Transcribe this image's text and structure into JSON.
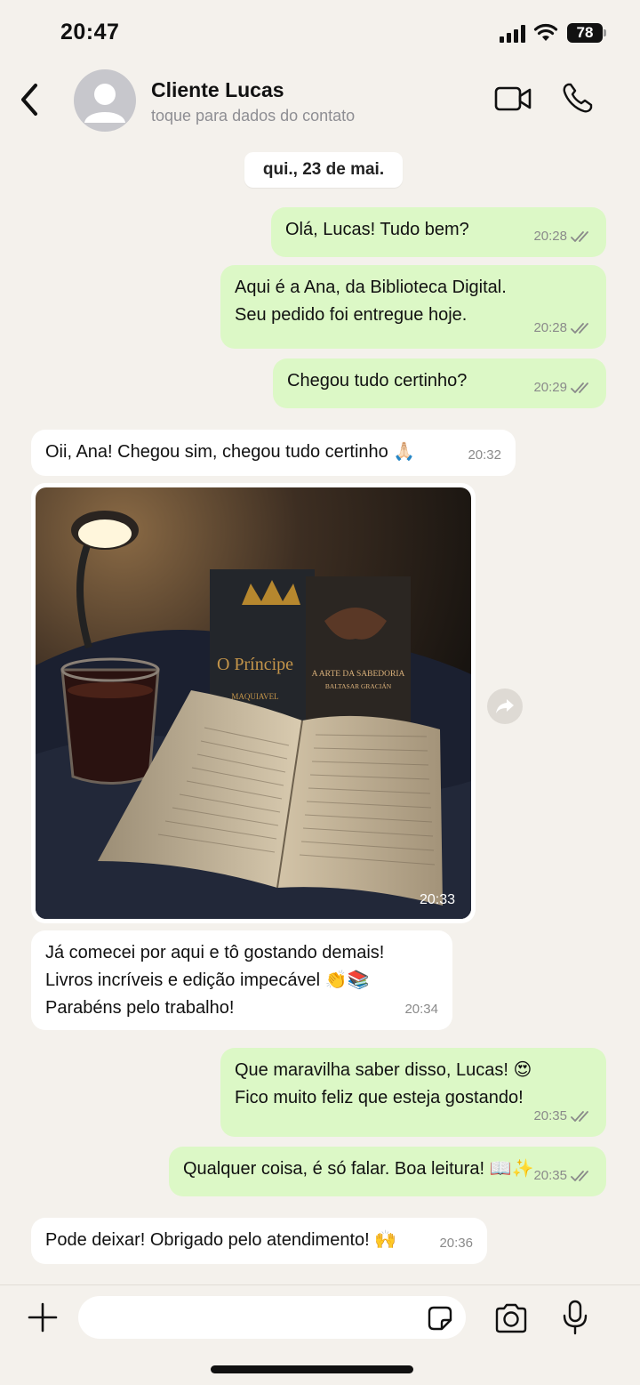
{
  "status_bar": {
    "time": "20:47",
    "battery": "78"
  },
  "header": {
    "contact_name": "Cliente Lucas",
    "contact_subtitle": "toque para dados do contato"
  },
  "chat": {
    "date_label": "qui., 23 de mai.",
    "messages": [
      {
        "direction": "out",
        "text": "Olá, Lucas! Tudo bem?",
        "time": "20:28",
        "status": "read"
      },
      {
        "direction": "out",
        "text": "Aqui é a Ana, da Biblioteca Digital.\nSeu pedido foi entregue hoje.",
        "time": "20:28",
        "status": "read"
      },
      {
        "direction": "out",
        "text": "Chegou tudo certinho?",
        "time": "20:29",
        "status": "read"
      },
      {
        "direction": "in",
        "text": "Oii, Ana! Chegou sim, chegou tudo certinho 🙏🏻",
        "time": "20:32"
      },
      {
        "direction": "in",
        "type": "image",
        "time": "20:33",
        "image_books": [
          "O Príncipe",
          "MAQUIAVEL",
          "A ARTE DA SABEDORIA",
          "BALTASAR GRACIÁN"
        ]
      },
      {
        "direction": "in",
        "text": "Já comecei por aqui e tô gostando demais!\nLivros incríveis e edição impecável 👏📚\nParabéns pelo trabalho!",
        "time": "20:34"
      },
      {
        "direction": "out",
        "text": "Que maravilha saber disso, Lucas! 😍\nFico muito feliz que esteja gostando!",
        "time": "20:35",
        "status": "read"
      },
      {
        "direction": "out",
        "text": "Qualquer coisa, é só falar. Boa leitura! 📖✨",
        "time": "20:35",
        "status": "read"
      },
      {
        "direction": "in",
        "text": "Pode deixar! Obrigado pelo atendimento! 🙌",
        "time": "20:36"
      }
    ]
  },
  "input": {
    "placeholder": ""
  },
  "colors": {
    "outgoing_bubble": "#dcf8c6",
    "incoming_bubble": "#ffffff",
    "background": "#f4f1ec"
  }
}
